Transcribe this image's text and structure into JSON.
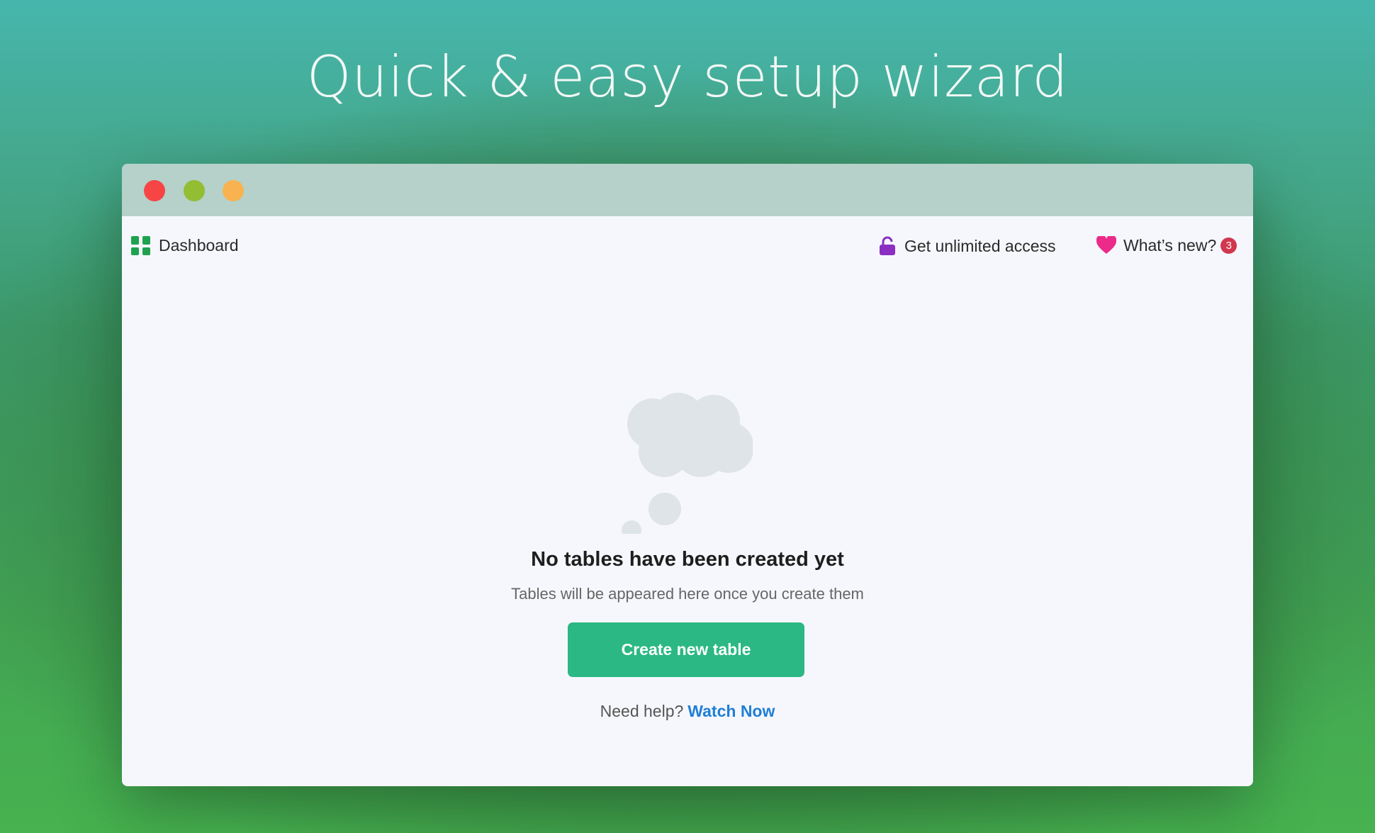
{
  "hero": {
    "title": "Quick & easy setup wizard"
  },
  "nav": {
    "dashboard": "Dashboard",
    "access": "Get unlimited access",
    "news": "What’s new?",
    "news_badge": "3"
  },
  "icons": {
    "dashboard": "grid-icon",
    "access": "unlock-icon",
    "news": "heart-icon",
    "empty": "thought-cloud-icon"
  },
  "colors": {
    "accent": "#2bb884",
    "link": "#1f7fd6",
    "badge": "#d0384f",
    "lock": "#8a2fc2",
    "heart": "#ec2a8a"
  },
  "empty_state": {
    "title": "No tables have been created yet",
    "subtitle": "Tables will be appeared here once you create them",
    "button": "Create new table",
    "help_text": "Need help?",
    "help_link": "Watch Now"
  }
}
